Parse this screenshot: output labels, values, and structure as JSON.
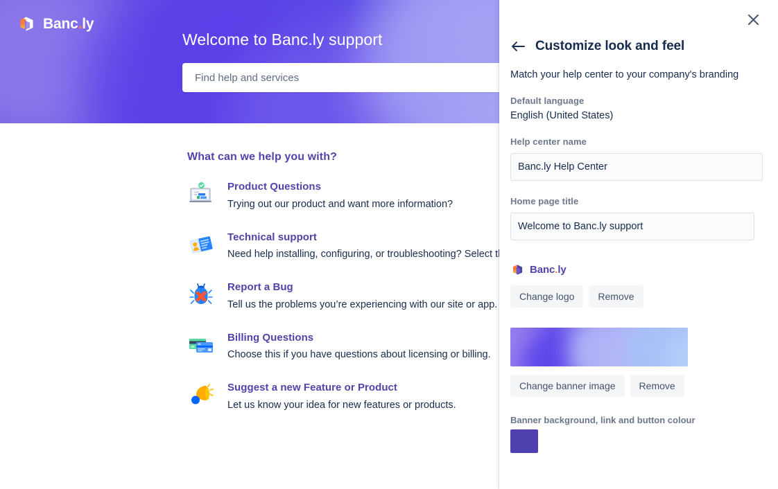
{
  "preview": {
    "brand": {
      "name_main": "Banc",
      "dot": ".",
      "name_suffix": "ly",
      "icon": "cube-logo-icon"
    },
    "banner": {
      "title": "Welcome to Banc.ly support"
    },
    "search": {
      "placeholder": "Find help and services",
      "value": ""
    },
    "content_heading": "What can we help you with?",
    "topics": [
      {
        "icon": "monitor-check-icon",
        "title": "Product Questions",
        "desc": "Trying out our product and want more information?"
      },
      {
        "icon": "tech-card-icon",
        "title": "Technical support",
        "desc": "Need help installing, configuring, or troubleshooting? Select this t"
      },
      {
        "icon": "bug-icon",
        "title": "Report a Bug",
        "desc": "Tell us the problems you’re experiencing with our site or app."
      },
      {
        "icon": "credit-cards-icon",
        "title": "Billing Questions",
        "desc": "Choose this if you have questions about licensing or billing."
      },
      {
        "icon": "megaphone-icon",
        "title": "Suggest a new Feature or Product",
        "desc": "Let us know your idea for new features or products."
      }
    ]
  },
  "drawer": {
    "close_icon": "close-icon",
    "back_icon": "arrow-left-icon",
    "title": "Customize look and feel",
    "subtitle": "Match your help center to your company's branding",
    "default_language_label": "Default language",
    "default_language_value": "English (United States)",
    "help_center_name_label": "Help center name",
    "help_center_name_value": "Banc.ly Help Center",
    "home_page_title_label": "Home page title",
    "home_page_title_value": "Welcome to Banc.ly support",
    "logo": {
      "name_main": "Banc",
      "dot": ".",
      "name_suffix": "ly"
    },
    "change_logo_label": "Change logo",
    "remove_logo_label": "Remove",
    "change_banner_label": "Change banner image",
    "remove_banner_label": "Remove",
    "colour_label": "Banner background, link and button colour",
    "colour_value": "#4E40AE"
  },
  "colors": {
    "accent_purple": "#5243AA",
    "brand_orange": "#F97C3C",
    "text_dark": "#172B4D",
    "text_muted": "#6B778C",
    "input_bg": "#FAFBFC",
    "input_border": "#DFE1E6",
    "ghost_btn_bg": "#F4F5F7"
  }
}
